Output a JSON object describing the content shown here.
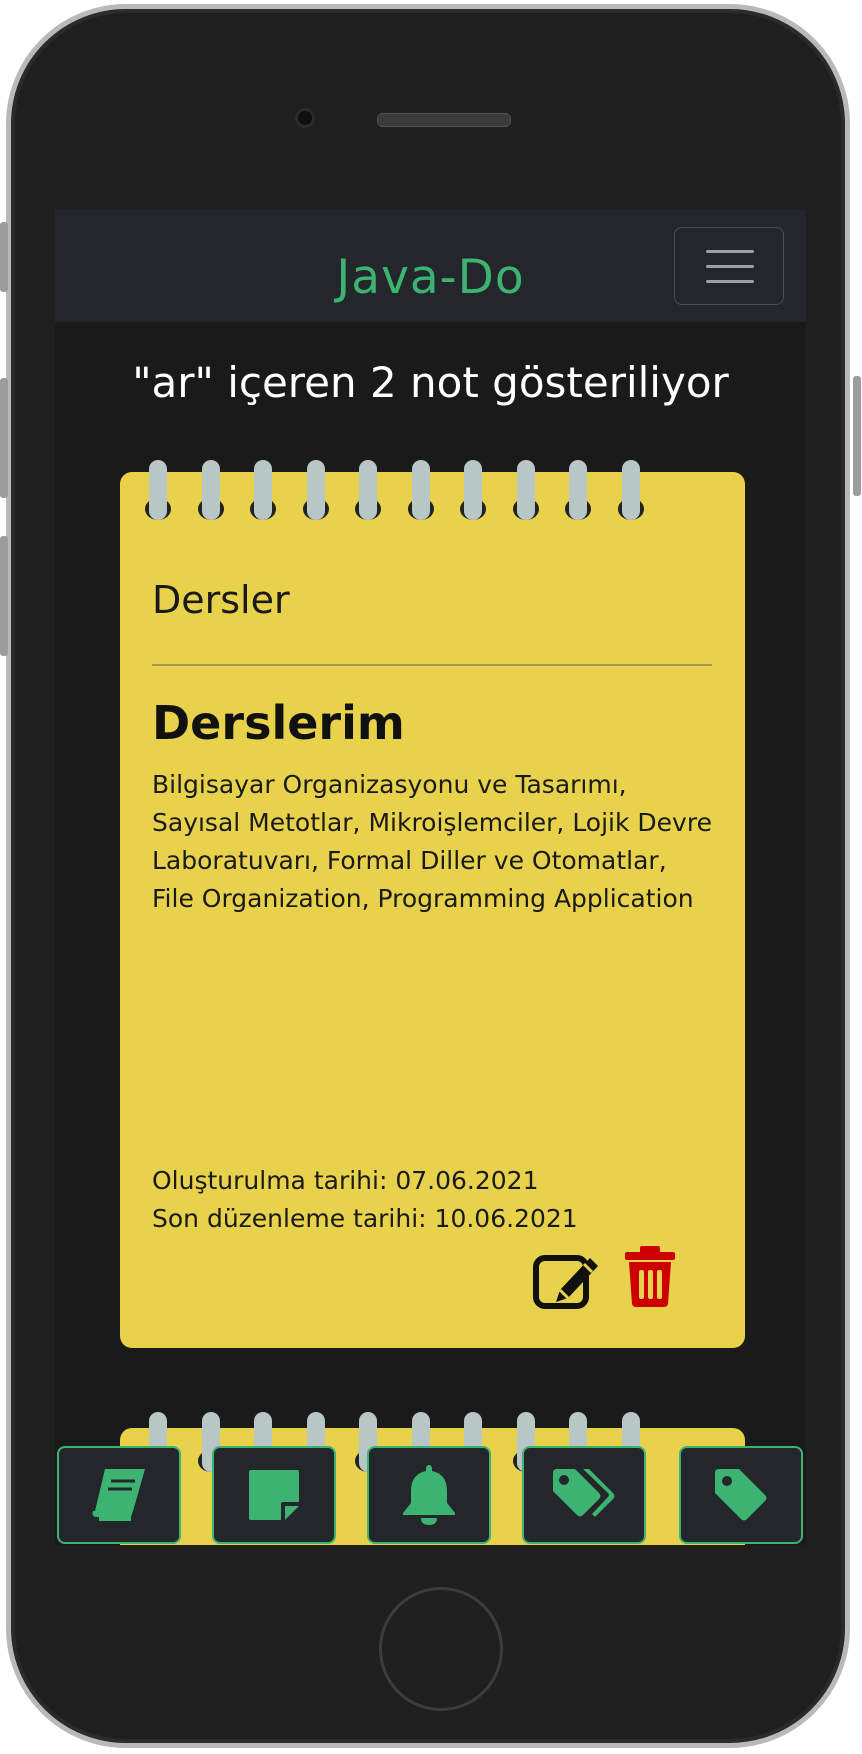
{
  "app": {
    "brand": "Java-Do"
  },
  "search": {
    "info": "\"ar\" içeren 2 not gösteriliyor"
  },
  "note": {
    "category": "Dersler",
    "title": "Derslerim",
    "body": "Bilgisayar Organizasyonu ve Tasarımı, Sayısal Metotlar, Mikroişlemciler, Lojik Devre Laboratuvarı, Formal Diller ve Otomatlar, File Organization, Programming Application",
    "created": "Oluşturulma tarihi: 07.06.2021",
    "edited": "Son düzenleme tarihi: 10.06.2021"
  },
  "icons": {
    "menu": "hamburger-icon",
    "edit": "edit-icon",
    "delete": "trash-icon",
    "nav": [
      "book-icon",
      "sticky-note-icon",
      "bell-icon",
      "tags-icon",
      "tag-icon"
    ]
  },
  "colors": {
    "accent": "#3cb371",
    "note": "#e8d24b",
    "delete": "#cc0000",
    "navbar": "#23272b"
  }
}
